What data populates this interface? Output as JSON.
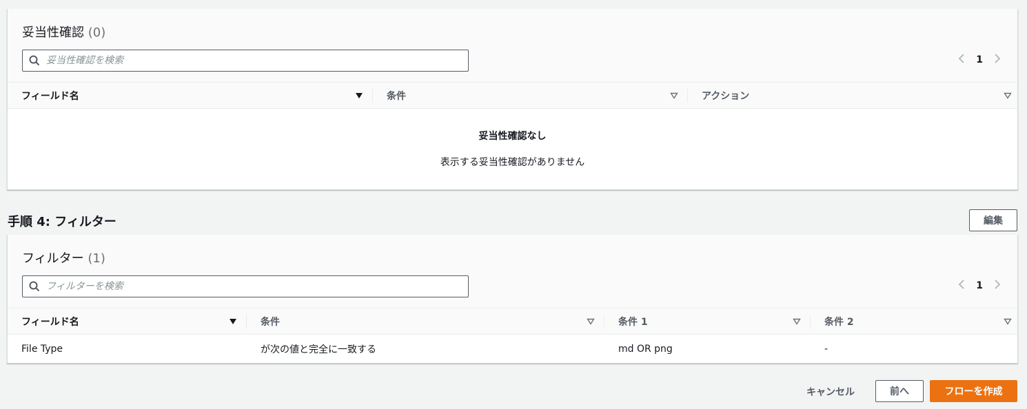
{
  "validation": {
    "title": "妥当性確認",
    "count": "(0)",
    "search_placeholder": "妥当性確認を検索",
    "page": "1",
    "columns": [
      "フィールド名",
      "条件",
      "アクション"
    ],
    "empty_title": "妥当性確認なし",
    "empty_desc": "表示する妥当性確認がありません"
  },
  "step4": {
    "title": "手順 4: フィルター",
    "edit_label": "編集"
  },
  "filter": {
    "title": "フィルター",
    "count": "(1)",
    "search_placeholder": "フィルターを検索",
    "page": "1",
    "columns": [
      "フィールド名",
      "条件",
      "条件 1",
      "条件 2"
    ],
    "rows": [
      {
        "field": "File Type",
        "condition": "が次の値と完全に一致する",
        "cond1": "md OR png",
        "cond2": "-"
      }
    ]
  },
  "footer": {
    "cancel_label": "キャンセル",
    "back_label": "前へ",
    "create_label": "フローを作成"
  },
  "colors": {
    "accent": "#ec7211",
    "border": "#545b64"
  },
  "icons": [
    "search-icon",
    "chevron-left-icon",
    "chevron-right-icon",
    "sort-desc-icon",
    "sort-icon"
  ]
}
